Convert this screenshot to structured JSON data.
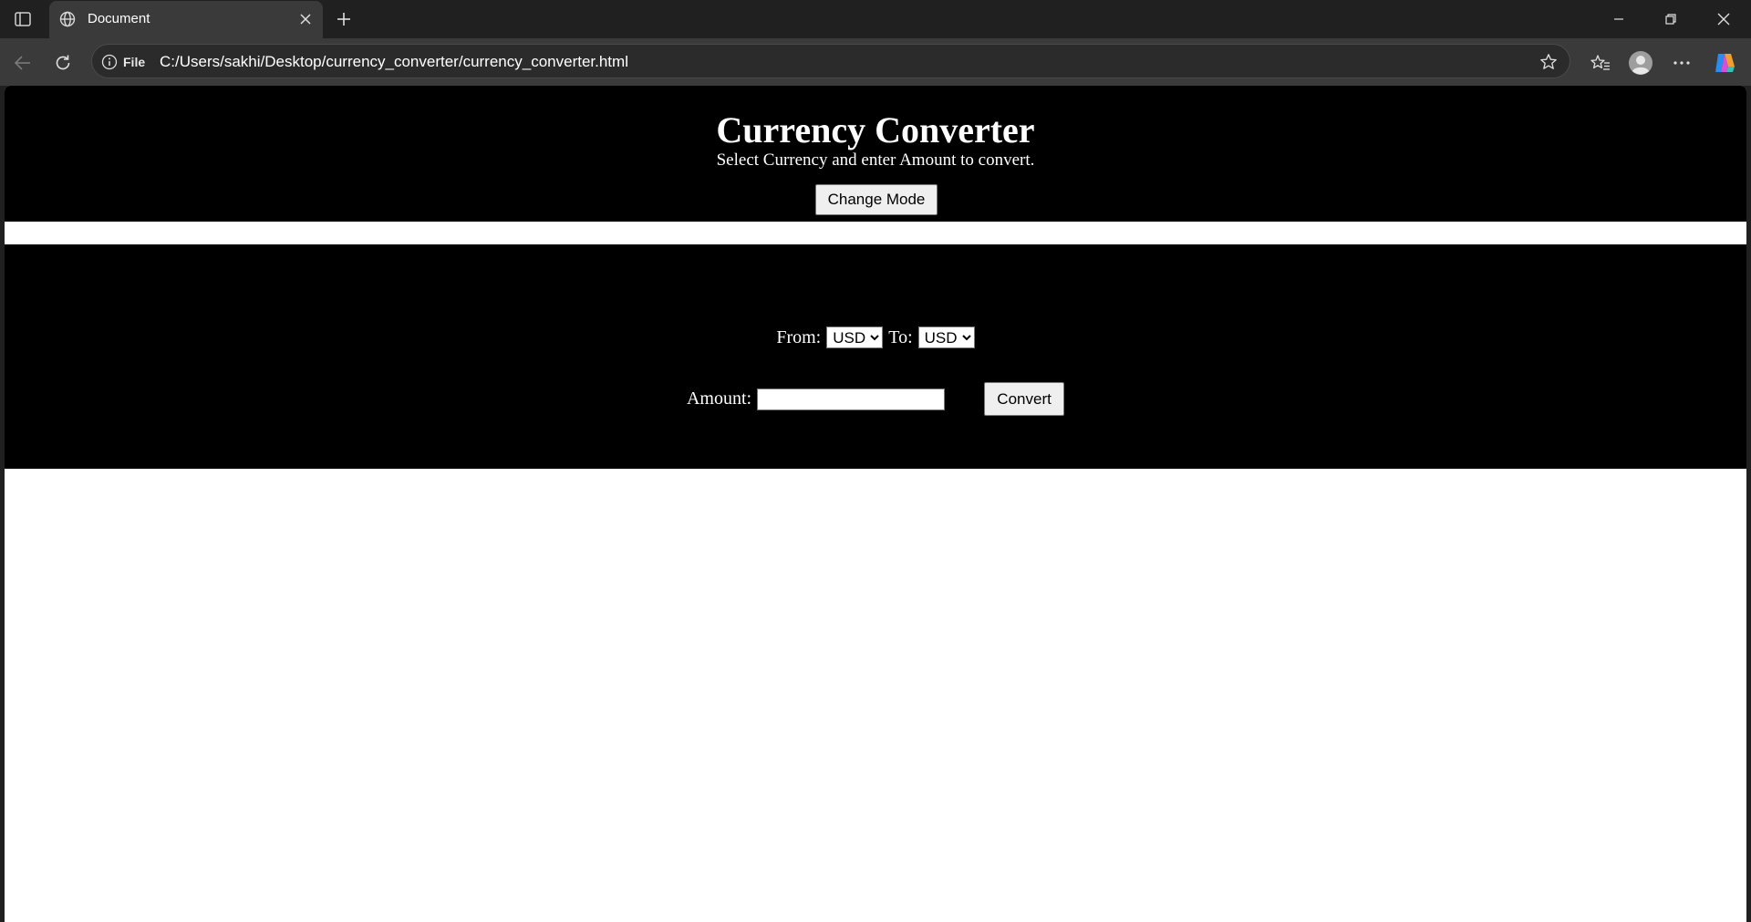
{
  "browser": {
    "tab": {
      "title": "Document",
      "favicon": "globe-icon"
    },
    "address": {
      "site_label": "File",
      "url": "C:/Users/sakhi/Desktop/currency_converter/currency_converter.html"
    },
    "accent_color": "#4a90e2"
  },
  "page": {
    "title": "Currency Converter",
    "subtitle": "Select Currency and enter Amount to convert.",
    "mode_button": "Change Mode",
    "from_label": "From:",
    "from_value": "USD",
    "to_label": "To:",
    "to_value": "USD",
    "amount_label": "Amount:",
    "amount_value": "",
    "convert_button": "Convert",
    "colors": {
      "header_bg": "#000000",
      "page_bg": "#ffffff",
      "text": "#ffffff"
    }
  }
}
